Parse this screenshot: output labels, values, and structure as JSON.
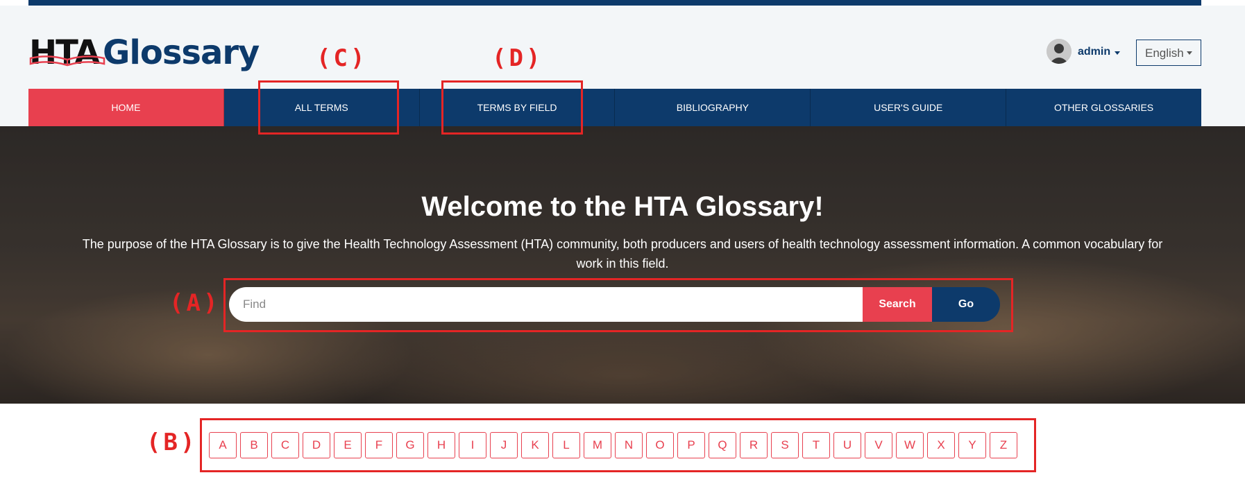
{
  "logo": {
    "part1": "HTA",
    "part2": "Glossary"
  },
  "user": {
    "name": "admin"
  },
  "language": {
    "selected": "English"
  },
  "nav": {
    "items": [
      {
        "label": "HOME"
      },
      {
        "label": "ALL TERMS"
      },
      {
        "label": "TERMS BY FIELD"
      },
      {
        "label": "BIBLIOGRAPHY"
      },
      {
        "label": "USER'S GUIDE"
      },
      {
        "label": "OTHER GLOSSARIES"
      }
    ]
  },
  "hero": {
    "title": "Welcome to the HTA Glossary!",
    "description": "The purpose of the HTA Glossary is to give the Health Technology Assessment (HTA) community, both producers and users of health technology assessment information. A common vocabulary for work in this field."
  },
  "search": {
    "placeholder": "Find",
    "search_label": "Search",
    "go_label": "Go"
  },
  "alphabet": [
    "A",
    "B",
    "C",
    "D",
    "E",
    "F",
    "G",
    "H",
    "I",
    "J",
    "K",
    "L",
    "M",
    "N",
    "O",
    "P",
    "Q",
    "R",
    "S",
    "T",
    "U",
    "V",
    "W",
    "X",
    "Y",
    "Z"
  ],
  "annotations": {
    "a": "(A)",
    "b": "(B)",
    "c": "(C)",
    "d": "(D)"
  },
  "colors": {
    "primary": "#0d3a6b",
    "accent": "#e8404f",
    "annotation": "#e42525"
  }
}
